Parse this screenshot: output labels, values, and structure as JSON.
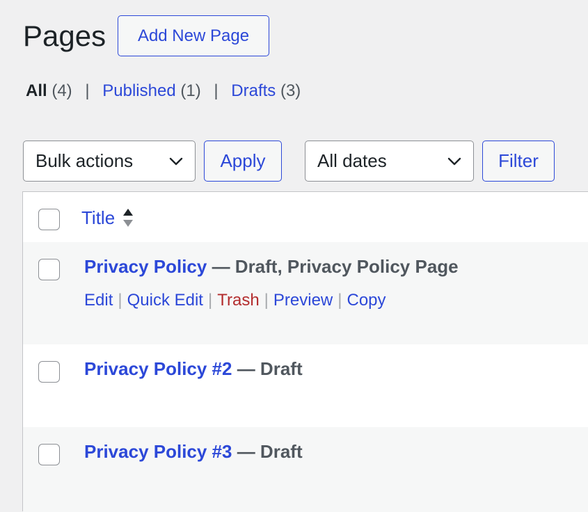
{
  "header": {
    "title": "Pages",
    "add_new_label": "Add New Page"
  },
  "filters": {
    "all_label": "All",
    "all_count": "(4)",
    "published_label": "Published",
    "published_count": "(1)",
    "drafts_label": "Drafts",
    "drafts_count": "(3)",
    "separator": "|"
  },
  "tablenav": {
    "bulk_actions_value": "Bulk actions",
    "apply_label": "Apply",
    "dates_value": "All dates",
    "filter_label": "Filter"
  },
  "table": {
    "column_title": "Title",
    "rows": [
      {
        "title": "Privacy Policy",
        "state": " — Draft, Privacy Policy Page",
        "actions": {
          "edit": "Edit",
          "quick_edit": "Quick Edit",
          "trash": "Trash",
          "preview": "Preview",
          "copy": "Copy"
        }
      },
      {
        "title": "Privacy Policy #2",
        "state": " — Draft"
      },
      {
        "title": "Privacy Policy #3",
        "state": " — Draft"
      }
    ]
  },
  "colors": {
    "link": "#2c48d8",
    "trash": "#b32d2e",
    "background": "#f0f0f1",
    "text": "#1d2327"
  },
  "icons": {
    "dropdown": "chevron-down-icon",
    "sort": "sort-icon"
  }
}
